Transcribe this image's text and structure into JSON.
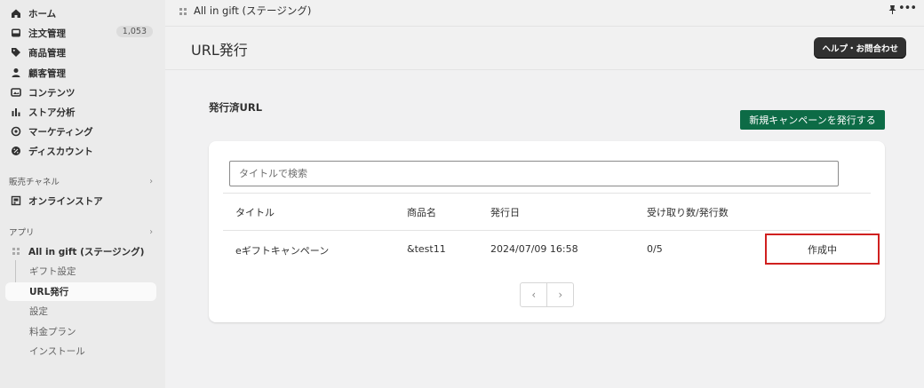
{
  "sidebar": {
    "nav": [
      {
        "label": "ホーム",
        "icon": "home-icon"
      },
      {
        "label": "注文管理",
        "icon": "inbox-icon",
        "badge": "1,053"
      },
      {
        "label": "商品管理",
        "icon": "tag-icon"
      },
      {
        "label": "顧客管理",
        "icon": "person-icon"
      },
      {
        "label": "コンテンツ",
        "icon": "image-icon"
      },
      {
        "label": "ストア分析",
        "icon": "bar-chart-icon"
      },
      {
        "label": "マーケティング",
        "icon": "target-icon"
      },
      {
        "label": "ディスカウント",
        "icon": "discount-icon"
      }
    ],
    "sales_channels": {
      "heading": "販売チャネル",
      "items": [
        {
          "label": "オンラインストア",
          "icon": "store-icon"
        }
      ]
    },
    "apps": {
      "heading": "アプリ",
      "app_name": "All in gift (ステージング)",
      "sub_items": [
        "ギフト設定",
        "URL発行",
        "設定",
        "料金プラン",
        "インストール"
      ]
    }
  },
  "topbar": {
    "app_title": "All in gift (ステージング)"
  },
  "header": {
    "title": "URL発行",
    "help_button": "ヘルプ・お問合わせ"
  },
  "main": {
    "section_title": "発行済URL",
    "new_campaign_button": "新規キャンペーンを発行する",
    "search": {
      "placeholder": "タイトルで検索",
      "value": ""
    },
    "table": {
      "columns": [
        "タイトル",
        "商品名",
        "発行日",
        "受け取り数/発行数"
      ],
      "rows": [
        {
          "title": "eギフトキャンペーン",
          "product": "&test11",
          "date": "2024/07/09 16:58",
          "count": "0/5",
          "status": "作成中"
        }
      ]
    },
    "pagination": {
      "prev": "‹",
      "next": "›"
    }
  },
  "colors": {
    "primary_button": "#0d6b46",
    "highlight_border": "#d0201f",
    "dark_button": "#303030"
  }
}
